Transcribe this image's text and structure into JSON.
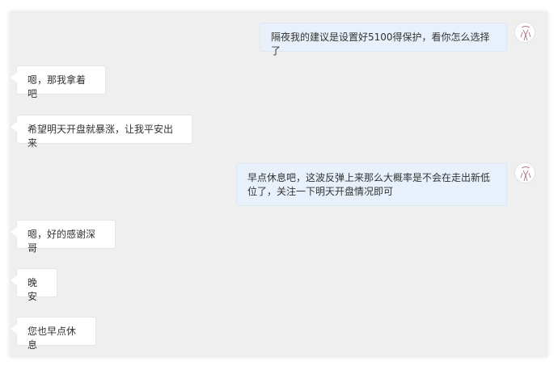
{
  "conversation": {
    "messages": [
      {
        "side": "outgoing",
        "text": "隔夜我的建议是设置好5100得保护，看你怎么选择了"
      },
      {
        "side": "incoming",
        "text": "嗯，那我拿着吧"
      },
      {
        "side": "incoming",
        "text": "希望明天开盘就暴涨，让我平安出来"
      },
      {
        "side": "outgoing",
        "line1": "早点休息吧，这波反弹上来那么大概率是不会在走出新低",
        "line2": "位了，关注一下明天开盘情况即可"
      },
      {
        "side": "incoming",
        "text": "嗯，好的感谢深哥"
      },
      {
        "side": "incoming",
        "text": "晚安"
      },
      {
        "side": "incoming",
        "text": "您也早点休息"
      }
    ]
  },
  "colors": {
    "background": "#efefef",
    "incoming_bubble": "#ffffff",
    "outgoing_bubble": "#e8f1fb",
    "text": "#333333"
  },
  "icons": {
    "avatar": "avatar-icon"
  }
}
